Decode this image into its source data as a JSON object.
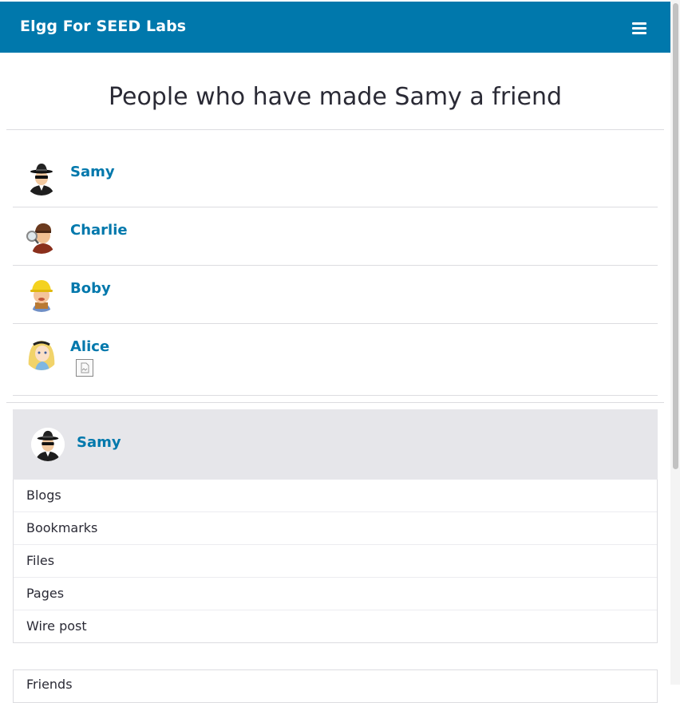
{
  "header": {
    "site_name": "Elgg For SEED Labs",
    "menu_icon": "hamburger-icon",
    "bg_color": "#0078ac"
  },
  "page": {
    "title": "People who have made Samy a friend"
  },
  "users": [
    {
      "name": "Samy",
      "avatar": "spy-avatar"
    },
    {
      "name": "Charlie",
      "avatar": "detective-avatar"
    },
    {
      "name": "Boby",
      "avatar": "builder-avatar"
    },
    {
      "name": "Alice",
      "avatar": "alice-avatar"
    }
  ],
  "owner": {
    "name": "Samy",
    "avatar": "spy-avatar"
  },
  "owner_menu": [
    "Blogs",
    "Bookmarks",
    "Files",
    "Pages",
    "Wire post"
  ],
  "friends_section": {
    "label": "Friends"
  }
}
